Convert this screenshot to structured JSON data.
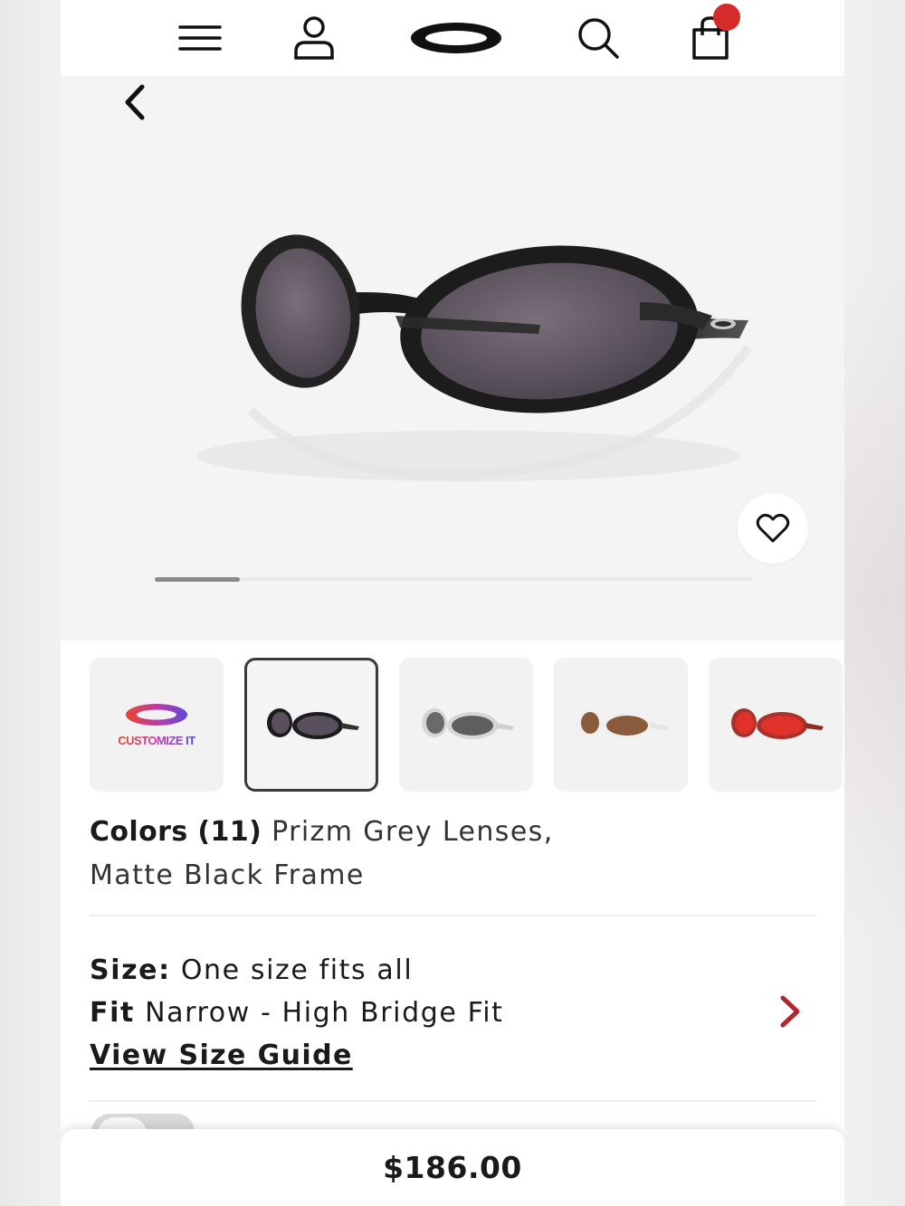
{
  "header": {
    "icons": [
      "menu-icon",
      "account-icon",
      "oakley-logo-icon",
      "search-icon",
      "shopping-bag-icon"
    ],
    "cart_badge_color": "#d62b2b"
  },
  "hero": {
    "back_icon": "chevron-left-icon",
    "wishlist_icon": "heart-icon",
    "carousel_position": 0.14
  },
  "thumbnails": [
    {
      "label": "CUSTOMIZE IT",
      "type": "customize"
    },
    {
      "type": "color",
      "lens": "#5a4f5c",
      "frame": "#1c1c1c",
      "selected": true
    },
    {
      "type": "color",
      "lens": "#5e5e5e",
      "frame": "#d6d6d6"
    },
    {
      "type": "color",
      "lens": "#8a5a3c",
      "frame": "#efefef"
    },
    {
      "type": "color",
      "lens": "#e0322b",
      "frame": "#a8322a"
    }
  ],
  "colors": {
    "label": "Colors (11)",
    "value_line1": "Prizm Grey Lenses,",
    "value_line2": "Matte Black Frame"
  },
  "size": {
    "label": "Size:",
    "value": "One size fits all",
    "fit_label": "Fit",
    "fit_value": "Narrow - High Bridge Fit",
    "guide_link": "View Size Guide"
  },
  "price": "$186.00",
  "accent_color": "#b3262b"
}
